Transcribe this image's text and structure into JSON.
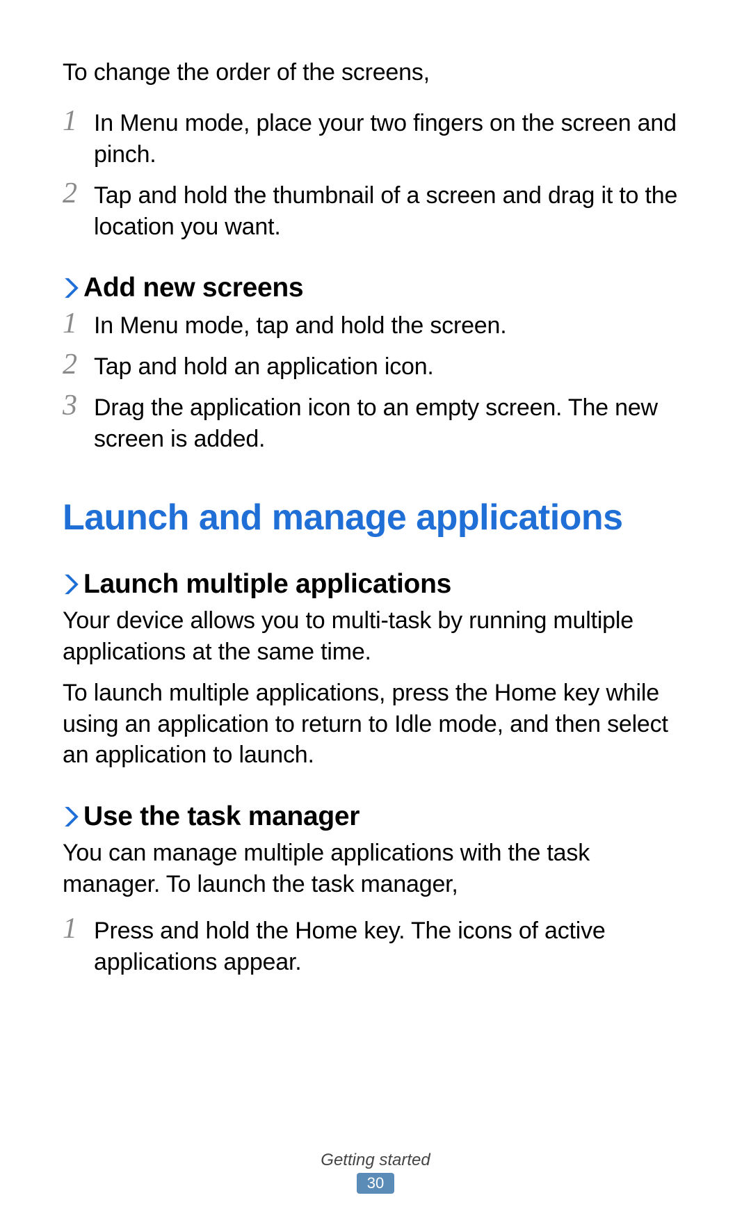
{
  "intro": "To change the order of the screens,",
  "steps_a": [
    "In Menu mode, place your two fingers on the screen and pinch.",
    "Tap and hold the thumbnail of a screen and drag it to the location you want."
  ],
  "section_b": {
    "heading": "Add new screens",
    "steps": [
      "In Menu mode, tap and hold the screen.",
      "Tap and hold an application icon.",
      "Drag the application icon to an empty screen. The new screen is added."
    ]
  },
  "main_heading": "Launch and manage applications",
  "section_c": {
    "heading": "Launch multiple applications",
    "paras": [
      "Your device allows you to multi-task by running multiple applications at the same time.",
      "To launch multiple applications, press the Home key while using an application to return to Idle mode, and then select an application to launch."
    ]
  },
  "section_d": {
    "heading": "Use the task manager",
    "paras": [
      "You can manage multiple applications with the task manager. To launch the task manager,"
    ],
    "steps": [
      "Press and hold the Home key. The icons of active applications appear."
    ]
  },
  "footer": {
    "label": "Getting started",
    "page": "30"
  },
  "numbers": [
    "1",
    "2",
    "3"
  ]
}
